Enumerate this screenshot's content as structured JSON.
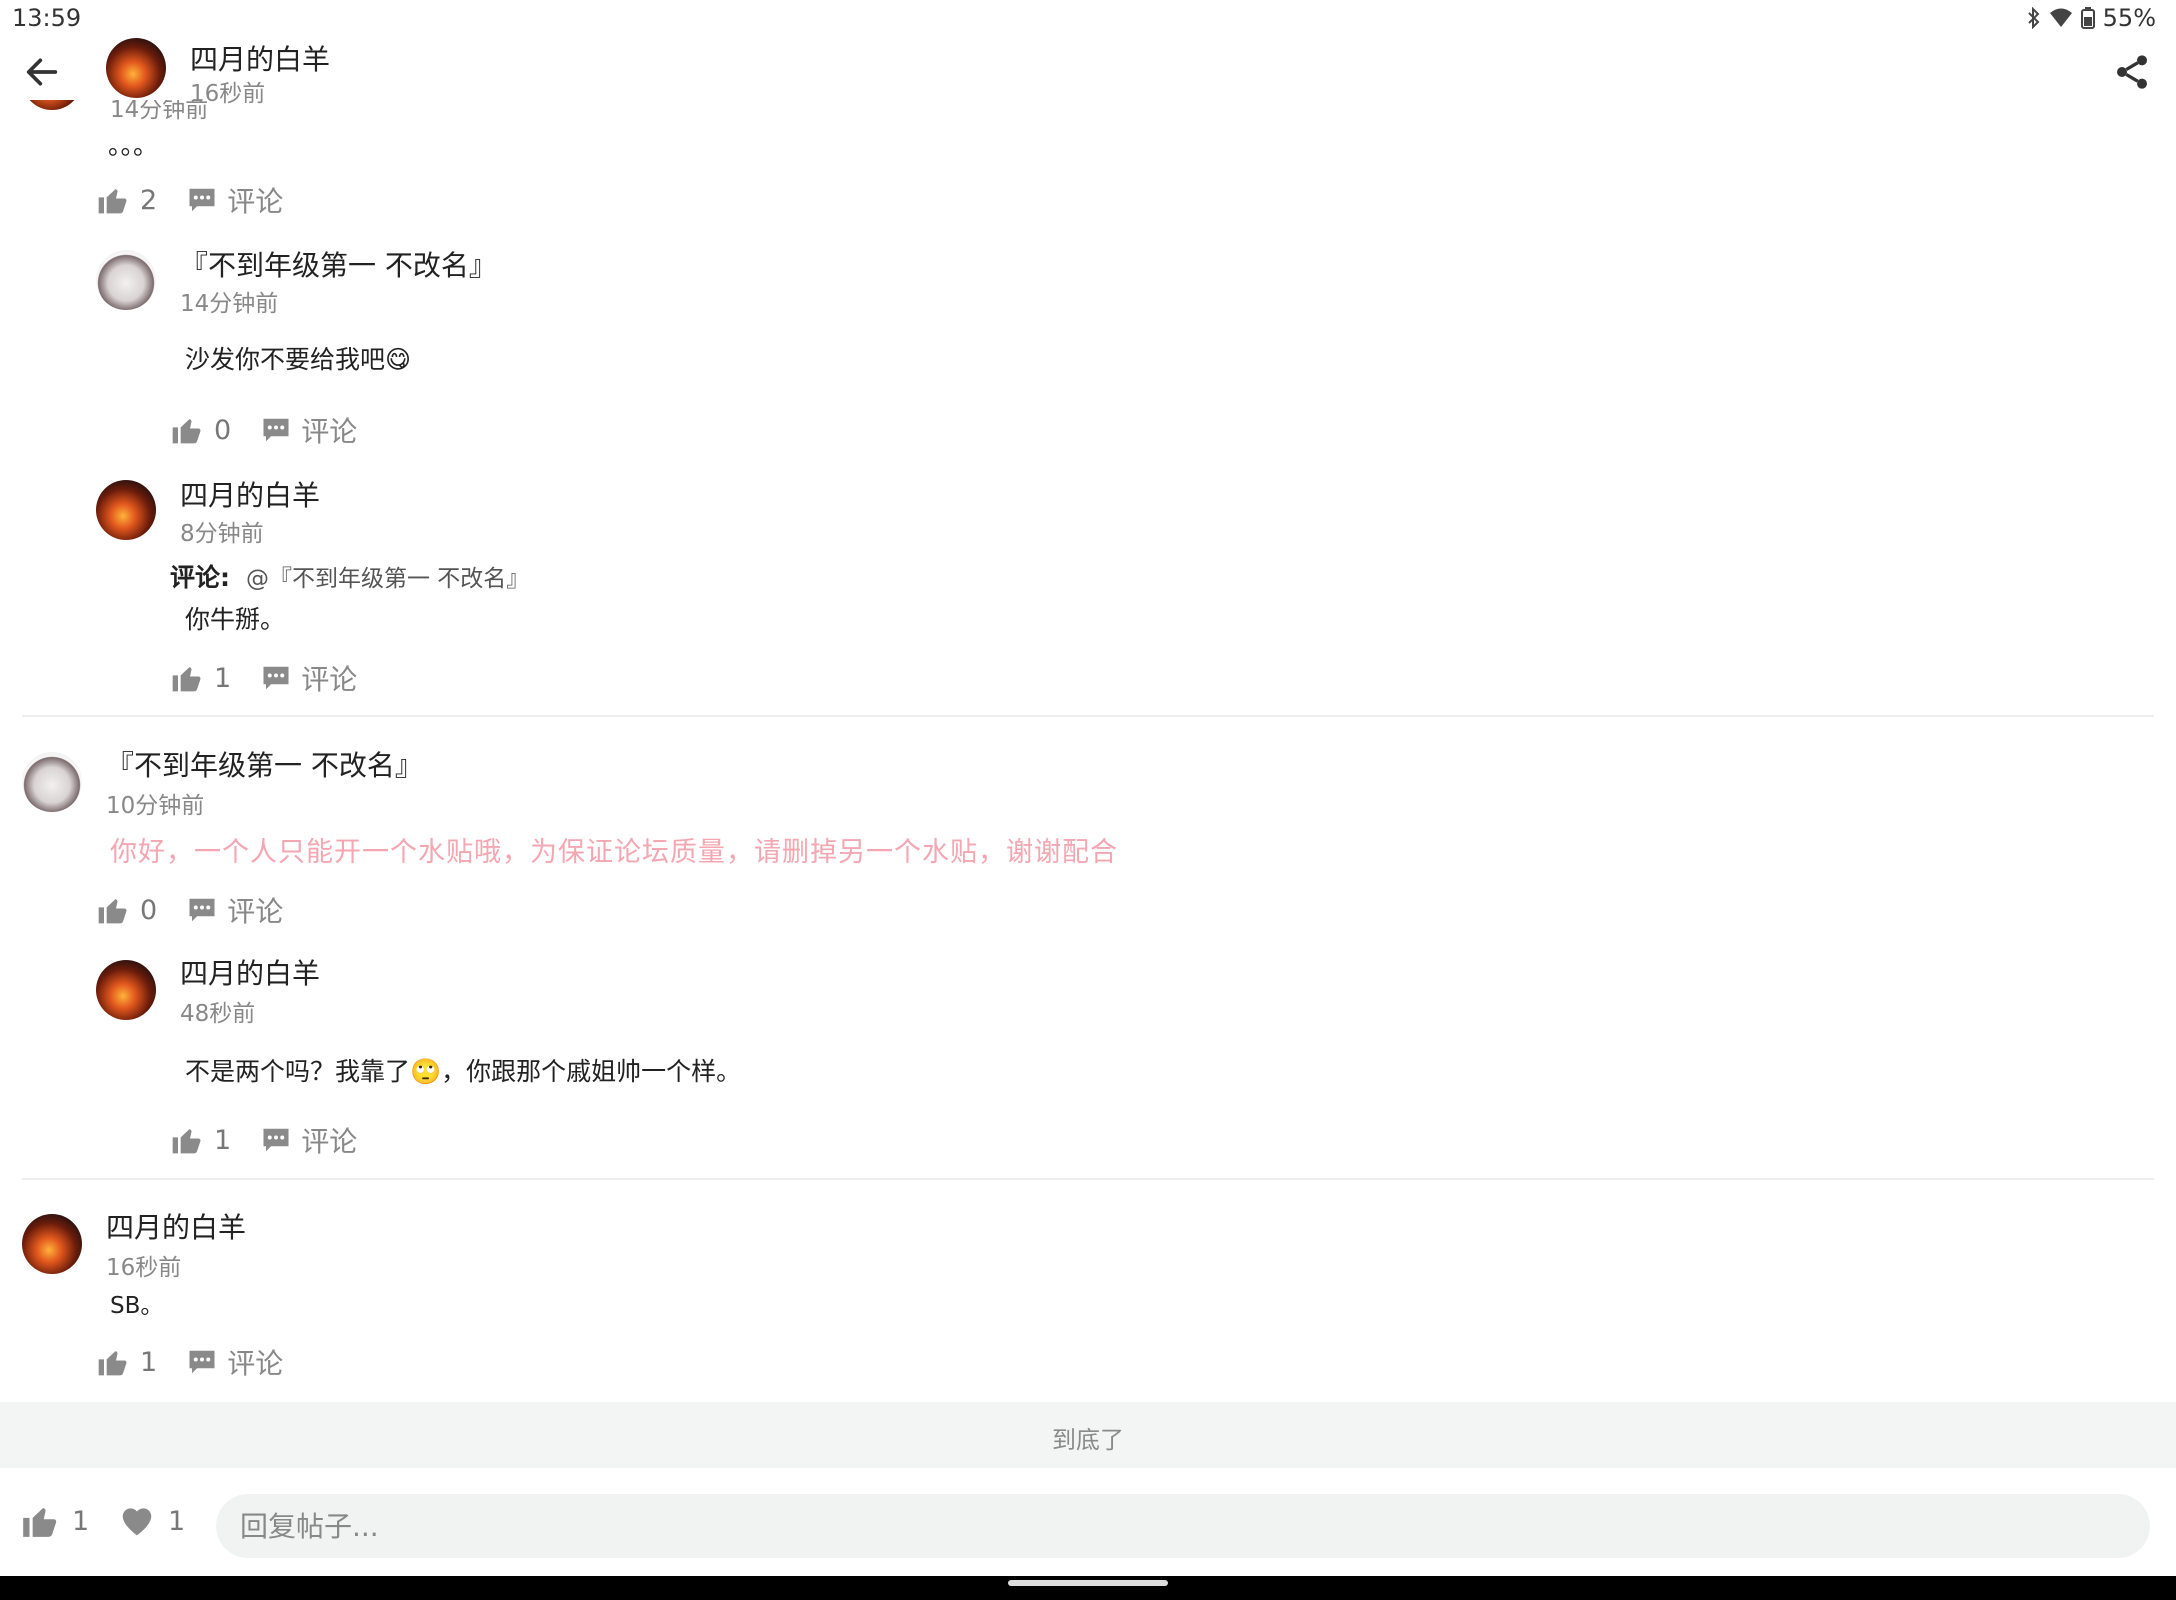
{
  "status_bar": {
    "time": "13:59",
    "battery": "55%"
  },
  "header": {
    "author": "四月的白羊",
    "time": "16秒前"
  },
  "top_partial": {
    "time": "14分钟前",
    "text": "。。。",
    "likes": "2",
    "comment_label": "评论"
  },
  "comments": [
    {
      "author": "『不到年级第一 不改名』",
      "time": "14分钟前",
      "text": "沙发你不要给我吧😋",
      "likes": "0",
      "comment_label": "评论"
    },
    {
      "author": "四月的白羊",
      "time": "8分钟前",
      "reply_prefix": "评论:",
      "reply_to": "@『不到年级第一 不改名』",
      "text": "你牛掰。",
      "likes": "1",
      "comment_label": "评论"
    },
    {
      "author": "『不到年级第一 不改名』",
      "time": "10分钟前",
      "text": "你好，一个人只能开一个水贴哦，为保证论坛质量，请删掉另一个水贴，谢谢配合",
      "likes": "0",
      "comment_label": "评论"
    },
    {
      "author": "四月的白羊",
      "time": "48秒前",
      "text": "不是两个吗？我靠了🙄，你跟那个戚姐帅一个样。",
      "likes": "1",
      "comment_label": "评论"
    },
    {
      "author": "四月的白羊",
      "time": "16秒前",
      "text": "SB。",
      "likes": "1",
      "comment_label": "评论"
    }
  ],
  "end_text": "到底了",
  "bottom": {
    "likes": "1",
    "favorites": "1",
    "reply_placeholder": "回复帖子..."
  },
  "colors": {
    "notice_text": "#f4a6b1",
    "muted": "#888888"
  },
  "icons": [
    "back-arrow-icon",
    "share-icon",
    "thumb-up-icon",
    "comment-bubble-icon",
    "heart-icon",
    "bluetooth-icon",
    "wifi-icon",
    "battery-icon"
  ]
}
